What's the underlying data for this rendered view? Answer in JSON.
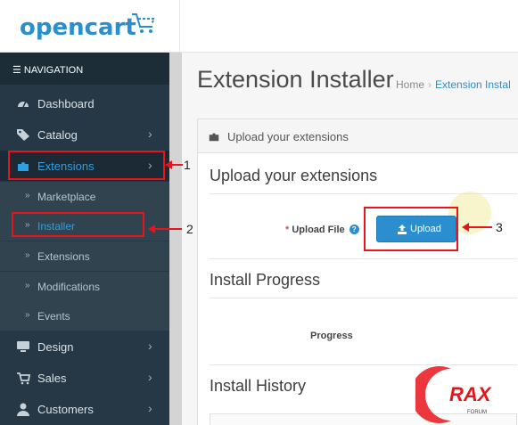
{
  "brand": {
    "logo_text": "opencart",
    "accent": "#2a8ecf"
  },
  "sidebar": {
    "heading": "NAVIGATION",
    "items": [
      {
        "label": "Dashboard",
        "icon": "dashboard-icon",
        "has_children": false
      },
      {
        "label": "Catalog",
        "icon": "tag-icon",
        "has_children": true
      },
      {
        "label": "Extensions",
        "icon": "puzzle-icon",
        "has_children": true,
        "active": true
      },
      {
        "label": "Design",
        "icon": "monitor-icon",
        "has_children": true
      },
      {
        "label": "Sales",
        "icon": "cart-icon",
        "has_children": true
      },
      {
        "label": "Customers",
        "icon": "user-icon",
        "has_children": true
      }
    ],
    "sub_items": [
      {
        "label": "Marketplace"
      },
      {
        "label": "Installer",
        "current": true
      },
      {
        "label": "Extensions"
      },
      {
        "label": "Modifications"
      },
      {
        "label": "Events"
      }
    ]
  },
  "page": {
    "title": "Extension Installer",
    "breadcrumb": [
      "Home",
      "Extension Instal"
    ]
  },
  "panel": {
    "heading": "Upload your extensions",
    "section_upload": "Upload your extensions",
    "upload_label": "Upload File",
    "upload_required_mark": "*",
    "upload_button": "Upload",
    "section_progress": "Install Progress",
    "progress_label": "Progress",
    "section_history": "Install History"
  },
  "annotations": {
    "numbers": [
      "1",
      "2",
      "3"
    ],
    "color": "#e8141b"
  },
  "watermark": {
    "letters": "RAX",
    "sub": "FORUM"
  }
}
